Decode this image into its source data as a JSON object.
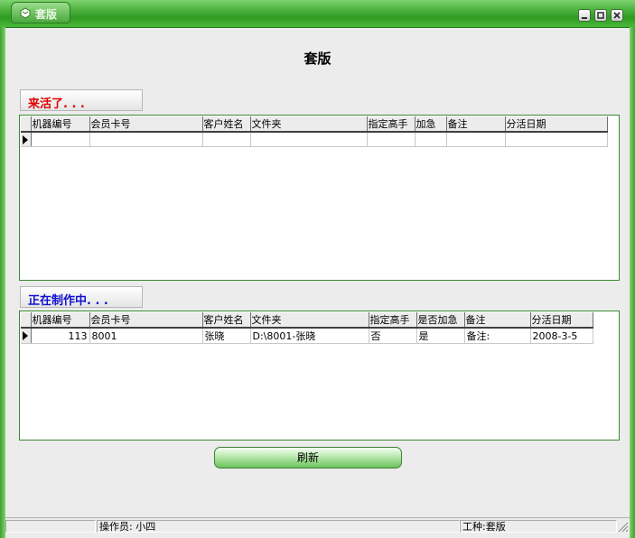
{
  "window": {
    "title": "套版",
    "accent": "#4fb340"
  },
  "page": {
    "title": "套版"
  },
  "section1": {
    "label": "来活了. . .",
    "color": "#e00000",
    "columns": [
      "机器编号",
      "会员卡号",
      "客户姓名",
      "文件夹",
      "指定高手",
      "加急",
      "备注",
      "分活日期"
    ],
    "rows": []
  },
  "section2": {
    "label": "正在制作中. . .",
    "color": "#1010d0",
    "columns": [
      "机器编号",
      "会员卡号",
      "客户姓名",
      "文件夹",
      "指定高手",
      "是否加急",
      "备注",
      "分活日期"
    ],
    "rows": [
      {
        "machine": "113",
        "card": "8001",
        "customer": "张晓",
        "folder": "D:\\8001-张晓",
        "expert": "否",
        "urgent": "是",
        "remark": "备注:",
        "date": "2008-3-5"
      }
    ]
  },
  "buttons": {
    "refresh": "刷新"
  },
  "statusbar": {
    "operator": "操作员: 小四",
    "job": "工种:套版"
  }
}
